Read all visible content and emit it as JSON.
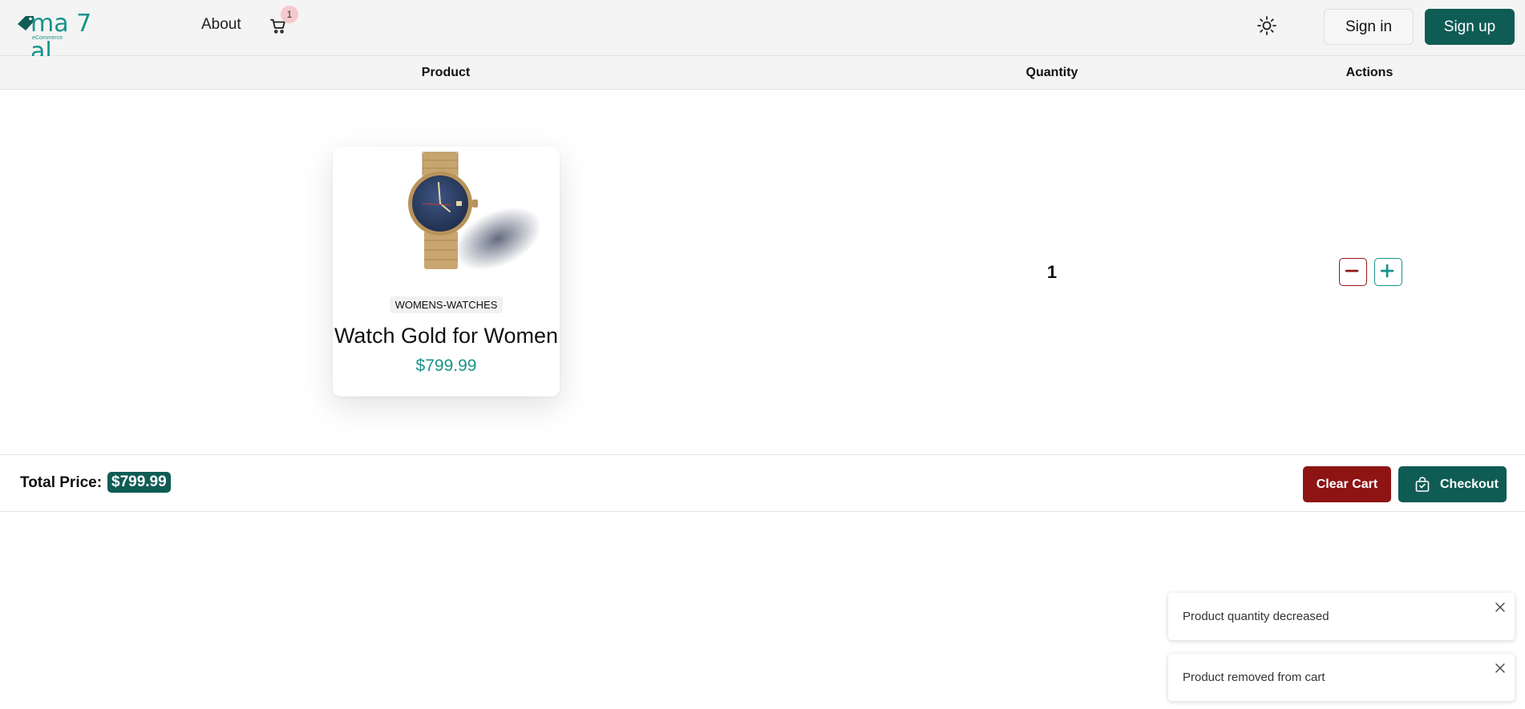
{
  "header": {
    "logo_text": "ma 7 al",
    "logo_sub": "eCommerce",
    "nav_about": "About",
    "cart_count": "1",
    "sign_in": "Sign in",
    "sign_up": "Sign up"
  },
  "table": {
    "col_product": "Product",
    "col_quantity": "Quantity",
    "col_actions": "Actions"
  },
  "item": {
    "category": "WOMENS-WATCHES",
    "name": "Watch Gold for Women",
    "price": "$799.99",
    "quantity": "1"
  },
  "summary": {
    "total_label": "Total Price:",
    "total_value": "$799.99",
    "clear_cart": "Clear Cart",
    "checkout": "Checkout"
  },
  "toasts": [
    {
      "message": "Product quantity decreased"
    },
    {
      "message": "Product removed from cart"
    }
  ],
  "colors": {
    "brand": "#0f5c55",
    "accent": "#17938a",
    "danger": "#8e1414"
  }
}
